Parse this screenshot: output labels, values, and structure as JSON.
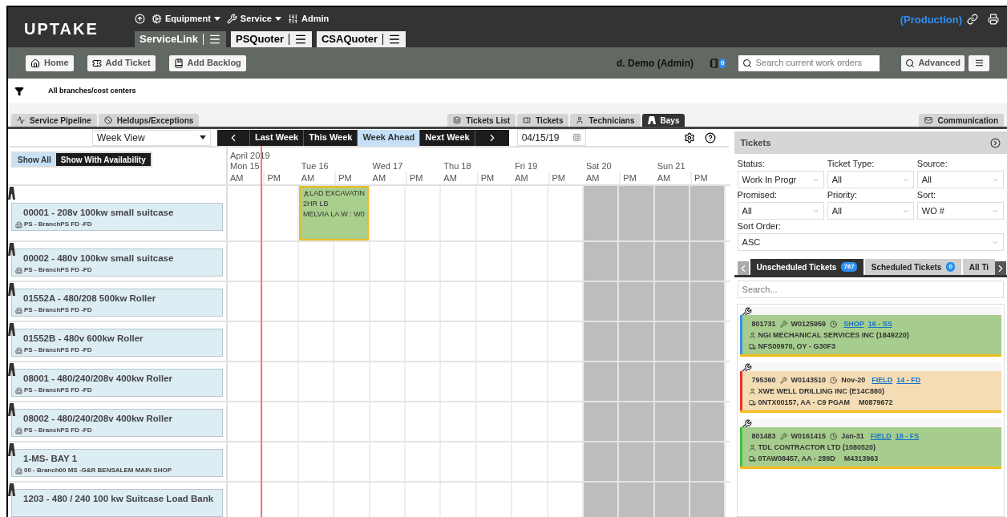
{
  "header": {
    "logo": "UPTAKE",
    "nav": [
      {
        "label": "Equipment",
        "menu": true
      },
      {
        "label": "Service",
        "menu": true
      },
      {
        "label": "Admin",
        "menu": false
      }
    ],
    "apps": [
      {
        "label": "ServiceLink",
        "selected": true
      },
      {
        "label": "PSQuoter",
        "selected": false
      },
      {
        "label": "CSAQuoter",
        "selected": false
      }
    ],
    "environment": "(Production)"
  },
  "toolbar": {
    "buttons": [
      "Home",
      "Add Ticket",
      "Add Backlog"
    ],
    "user": "d. Demo (Admin)",
    "notifications": "0",
    "search": {
      "placeholder": "Search current work orders"
    },
    "advanced": "Advanced"
  },
  "filter": {
    "label": "All branches/cost centers"
  },
  "tabs": {
    "left": [
      {
        "label": "Service Pipeline",
        "selected": false
      },
      {
        "label": "Heldups/Exceptions",
        "selected": false
      }
    ],
    "center": [
      {
        "label": "Tickets List",
        "selected": false
      },
      {
        "label": "Tickets",
        "selected": false
      },
      {
        "label": "Technicians",
        "selected": false
      },
      {
        "label": "Bays",
        "selected": true
      }
    ],
    "right": [
      {
        "label": "Communication",
        "selected": false
      }
    ]
  },
  "scheduler": {
    "view": "Week View",
    "nav": [
      {
        "label": "Last Week",
        "selected": false
      },
      {
        "label": "This Week",
        "selected": false
      },
      {
        "label": "Week Ahead",
        "selected": true
      },
      {
        "label": "Next Week",
        "selected": false
      }
    ],
    "date": "04/15/19",
    "availability": [
      {
        "label": "Show All",
        "selected": true
      },
      {
        "label": "Show With Availability",
        "selected": false
      }
    ],
    "month": "April 2019",
    "days": [
      {
        "label": "Mon 15",
        "halves": [
          "AM",
          "PM"
        ],
        "weekend": false
      },
      {
        "label": "Tue 16",
        "halves": [
          "AM",
          "PM"
        ],
        "weekend": false
      },
      {
        "label": "Wed 17",
        "halves": [
          "AM",
          "PM"
        ],
        "weekend": false
      },
      {
        "label": "Thu 18",
        "halves": [
          "AM",
          "PM"
        ],
        "weekend": false
      },
      {
        "label": "Fri 19",
        "halves": [
          "AM",
          "PM"
        ],
        "weekend": false
      },
      {
        "label": "Sat 20",
        "halves": [
          "AM",
          "PM"
        ],
        "weekend": true
      },
      {
        "label": "Sun 21",
        "halves": [
          "AM",
          "PM"
        ],
        "weekend": true
      }
    ],
    "bays": [
      {
        "name": "00001 - 208v 100kw small suitcase",
        "branch": "PS - BranchPS FD -FD",
        "booking": {
          "lines": [
            "LAD EXCAVATIN",
            "2HR LB",
            "MELVIA LA W : W0"
          ]
        }
      },
      {
        "name": "00002 - 480v 100kw small suitcase",
        "branch": "PS - BranchPS FD -FD"
      },
      {
        "name": "01552A - 480/208 500kw Roller",
        "branch": "PS - BranchPS FD -FD"
      },
      {
        "name": "01552B - 480v 600kw Roller",
        "branch": "PS - BranchPS FD -FD"
      },
      {
        "name": "08001 - 480/240/208v 400kw Roller",
        "branch": "PS - BranchPS FD -FD"
      },
      {
        "name": "08002 - 480/240/208v 400kw Roller",
        "branch": "PS - BranchPS FD -FD"
      },
      {
        "name": "1-MS- BAY 1",
        "branch": "00 - Branch00 MS -G&R BENSALEM MAIN SHOP"
      },
      {
        "name": "1203 - 480 / 240 100 kw Suitcase Load Bank"
      }
    ]
  },
  "tickets_panel": {
    "title": "Tickets",
    "filters": [
      {
        "label": "Status:",
        "value": "Work In Progr"
      },
      {
        "label": "Ticket Type:",
        "value": "All"
      },
      {
        "label": "Source:",
        "value": "All"
      },
      {
        "label": "Promised:",
        "value": "All"
      },
      {
        "label": "Priority:",
        "value": "All"
      },
      {
        "label": "Sort:",
        "value": "WO #"
      }
    ],
    "sort_order": {
      "label": "Sort Order:",
      "value": "ASC"
    },
    "subtabs": [
      {
        "label": "Unscheduled Tickets",
        "count": "787",
        "selected": true
      },
      {
        "label": "Scheduled Tickets",
        "count": "0",
        "selected": false
      },
      {
        "label": "All Ti",
        "selected": false
      }
    ],
    "search": {
      "placeholder": "Search..."
    },
    "tickets": [
      {
        "number": "801731",
        "wo": "W0125959",
        "location": "SHOP",
        "code": "16 - SS",
        "customer": "NGI MECHANICAL SERVICES INC (1849220)",
        "equipment": "NFS00970, OY - G30F3",
        "color": "#3b8fe8",
        "kind": "normal"
      },
      {
        "number": "795360",
        "wo": "W0143510",
        "date": "Nov-20",
        "location": "FIELD",
        "code": "14 - FD",
        "customer": "XWE WELL DRILLING INC (E14C880)",
        "equipment": "0NTX00157, AA - C9 PGAM",
        "model": "M0879672",
        "color": "#e8302a",
        "kind": "warning"
      },
      {
        "number": "801483",
        "wo": "W0161415",
        "date": "Jan-31",
        "location": "FIELD",
        "code": "18 - FS",
        "customer": "TDL CONTRACTOR LTD (1080520)",
        "equipment": "0TAW08457, AA - 289D",
        "model": "M4313963",
        "color": "#3fc23f",
        "kind": "normal"
      }
    ]
  }
}
